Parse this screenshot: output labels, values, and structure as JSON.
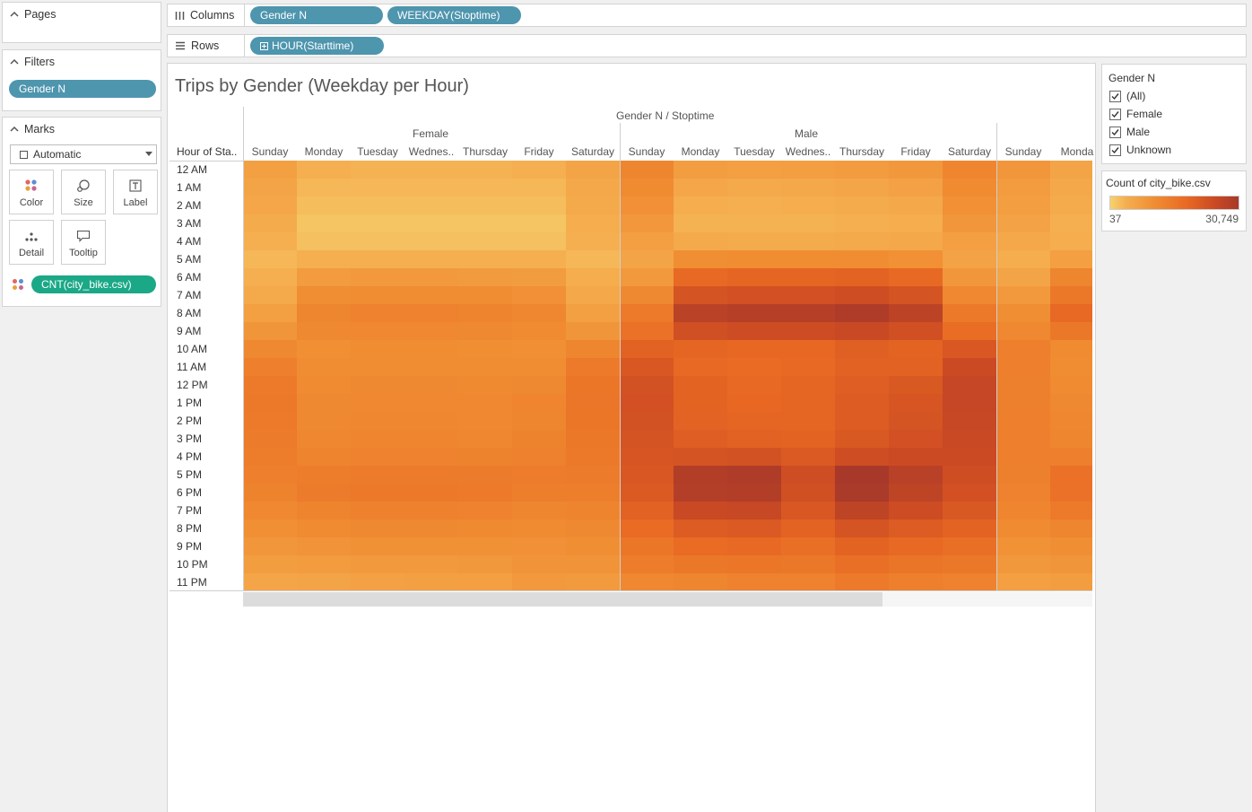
{
  "pages": {
    "title": "Pages"
  },
  "filters": {
    "title": "Filters",
    "pills": [
      "Gender N"
    ]
  },
  "marks": {
    "title": "Marks",
    "type": "Automatic",
    "buttons": [
      "Color",
      "Size",
      "Label",
      "Detail",
      "Tooltip"
    ],
    "measure_pill": "CNT(city_bike.csv)"
  },
  "columns_shelf": {
    "label": "Columns",
    "pills": [
      "Gender N",
      "WEEKDAY(Stoptime)"
    ]
  },
  "rows_shelf": {
    "label": "Rows",
    "pills": [
      "HOUR(Starttime)"
    ]
  },
  "viz": {
    "title": "Trips by Gender (Weekday per Hour)",
    "top_header": "Gender N / Stoptime",
    "row_header_title": "Hour of Sta..",
    "groups": [
      "Female",
      "Male",
      ""
    ],
    "day_labels": [
      "Sunday",
      "Monday",
      "Tuesday",
      "Wednes..",
      "Thursday",
      "Friday",
      "Saturday",
      "Sunday",
      "Monday",
      "Tuesday",
      "Wednes..",
      "Thursday",
      "Friday",
      "Saturday",
      "Sunday",
      "Monda"
    ]
  },
  "gender_legend": {
    "title": "Gender N",
    "items": [
      "(All)",
      "Female",
      "Male",
      "Unknown"
    ]
  },
  "color_legend": {
    "title": "Count of city_bike.csv",
    "min_label": "37",
    "max_label": "30,749",
    "min_color": "#f6c358",
    "max_color": "#a8392a"
  },
  "chart_data": {
    "type": "heatmap",
    "title": "Trips by Gender (Weekday per Hour)",
    "xlabel": "Gender N / Stoptime",
    "ylabel": "Hour of Sta..",
    "y_categories": [
      "12 AM",
      "1 AM",
      "2 AM",
      "3 AM",
      "4 AM",
      "5 AM",
      "6 AM",
      "7 AM",
      "8 AM",
      "9 AM",
      "10 AM",
      "11 AM",
      "12 PM",
      "1 PM",
      "2 PM",
      "3 PM",
      "4 PM",
      "5 PM",
      "6 PM",
      "7 PM",
      "8 PM",
      "9 PM",
      "10 PM",
      "11 PM"
    ],
    "x_groups": [
      {
        "name": "Female",
        "days": [
          "Sunday",
          "Monday",
          "Tuesday",
          "Wednes..",
          "Thursday",
          "Friday",
          "Saturday"
        ]
      },
      {
        "name": "Male",
        "days": [
          "Sunday",
          "Monday",
          "Tuesday",
          "Wednes..",
          "Thursday",
          "Friday",
          "Saturday"
        ]
      },
      {
        "name": "",
        "days": [
          "Sunday",
          "Monda"
        ]
      }
    ],
    "color_range": [
      37,
      30749
    ],
    "series": [
      {
        "name": "Female",
        "values": [
          [
            1500,
            500,
            400,
            400,
            400,
            500,
            1200
          ],
          [
            1200,
            300,
            300,
            300,
            300,
            300,
            900
          ],
          [
            1000,
            200,
            200,
            200,
            200,
            200,
            800
          ],
          [
            700,
            100,
            100,
            100,
            100,
            100,
            600
          ],
          [
            500,
            150,
            150,
            150,
            150,
            150,
            500
          ],
          [
            300,
            500,
            500,
            500,
            500,
            500,
            300
          ],
          [
            500,
            2000,
            2200,
            2200,
            2100,
            1900,
            600
          ],
          [
            800,
            3500,
            3800,
            3800,
            3600,
            3200,
            900
          ],
          [
            1500,
            5000,
            5400,
            5400,
            5200,
            4600,
            1500
          ],
          [
            2600,
            4200,
            4500,
            4500,
            4300,
            3900,
            2600
          ],
          [
            4200,
            3400,
            3600,
            3600,
            3500,
            3400,
            5000
          ],
          [
            6000,
            3600,
            3800,
            3800,
            3700,
            3600,
            7000
          ],
          [
            7000,
            4000,
            4200,
            4200,
            4100,
            4300,
            8000
          ],
          [
            7200,
            4200,
            4500,
            4500,
            4400,
            4800,
            8200
          ],
          [
            7000,
            4300,
            4600,
            4600,
            4500,
            5000,
            8000
          ],
          [
            6800,
            4600,
            4800,
            4800,
            4700,
            5300,
            7800
          ],
          [
            6500,
            5200,
            5400,
            5400,
            5300,
            5700,
            7400
          ],
          [
            6000,
            6500,
            6800,
            6800,
            6600,
            6400,
            6800
          ],
          [
            5300,
            6800,
            7200,
            7200,
            7000,
            6200,
            6200
          ],
          [
            4400,
            5200,
            5600,
            5600,
            5400,
            5000,
            5200
          ],
          [
            3400,
            3900,
            4200,
            4200,
            4100,
            3900,
            4300
          ],
          [
            2500,
            2900,
            3100,
            3100,
            3100,
            3200,
            3500
          ],
          [
            1800,
            2000,
            2200,
            2200,
            2300,
            2700,
            2900
          ],
          [
            1100,
            1200,
            1400,
            1500,
            1600,
            2200,
            2100
          ]
        ]
      },
      {
        "name": "Male",
        "values": [
          [
            5000,
            1800,
            1600,
            1700,
            2000,
            2300,
            4800
          ],
          [
            4000,
            1000,
            800,
            900,
            1100,
            1400,
            4000
          ],
          [
            3200,
            600,
            500,
            600,
            700,
            900,
            3300
          ],
          [
            2400,
            400,
            400,
            400,
            500,
            600,
            2500
          ],
          [
            1600,
            800,
            700,
            700,
            800,
            900,
            1600
          ],
          [
            1200,
            3500,
            3800,
            3800,
            3700,
            3300,
            1300
          ],
          [
            2200,
            11000,
            12000,
            12000,
            12500,
            11000,
            2500
          ],
          [
            4300,
            17000,
            18000,
            18000,
            19000,
            17000,
            4500
          ],
          [
            7000,
            25000,
            26500,
            26500,
            28500,
            24500,
            7300
          ],
          [
            9000,
            18500,
            19500,
            19500,
            21000,
            18500,
            10000
          ],
          [
            13000,
            12000,
            11500,
            11500,
            13500,
            12500,
            16000
          ],
          [
            16000,
            11000,
            10500,
            11000,
            13000,
            12800,
            20000
          ],
          [
            17500,
            12500,
            11200,
            12000,
            14000,
            15500,
            22000
          ],
          [
            18000,
            12500,
            11500,
            12000,
            14500,
            16500,
            22000
          ],
          [
            17500,
            12700,
            12000,
            12000,
            14500,
            17000,
            21500
          ],
          [
            17000,
            14000,
            13000,
            12500,
            15500,
            18000,
            21000
          ],
          [
            16500,
            17000,
            17500,
            15000,
            19000,
            20000,
            20000
          ],
          [
            16000,
            27500,
            28500,
            19000,
            30749,
            25500,
            19000
          ],
          [
            15000,
            27000,
            27500,
            18500,
            30000,
            24000,
            18000
          ],
          [
            13000,
            21000,
            21500,
            16000,
            24000,
            19500,
            15500
          ],
          [
            10500,
            14500,
            15000,
            12500,
            17000,
            14500,
            12500
          ],
          [
            8000,
            10500,
            11000,
            9500,
            12500,
            11000,
            9500
          ],
          [
            6500,
            7500,
            8000,
            7500,
            9500,
            8500,
            7500
          ],
          [
            4500,
            5000,
            5500,
            5500,
            7000,
            6000,
            5500
          ]
        ]
      },
      {
        "name": "Unknown",
        "values": [
          [
            2500,
            1200
          ],
          [
            2000,
            900
          ],
          [
            1700,
            700
          ],
          [
            1300,
            500
          ],
          [
            900,
            600
          ],
          [
            600,
            1600
          ],
          [
            1200,
            5000
          ],
          [
            2200,
            7500
          ],
          [
            3500,
            11000
          ],
          [
            4500,
            7500
          ],
          [
            6000,
            4000
          ],
          [
            6000,
            3800
          ],
          [
            5800,
            4000
          ],
          [
            5800,
            4200
          ],
          [
            6000,
            4600
          ],
          [
            6000,
            5000
          ],
          [
            6000,
            6000
          ],
          [
            5800,
            9000
          ],
          [
            5500,
            9000
          ],
          [
            4800,
            7000
          ],
          [
            4000,
            5000
          ],
          [
            3000,
            3500
          ],
          [
            2300,
            2600
          ],
          [
            1600,
            1800
          ]
        ]
      }
    ]
  }
}
